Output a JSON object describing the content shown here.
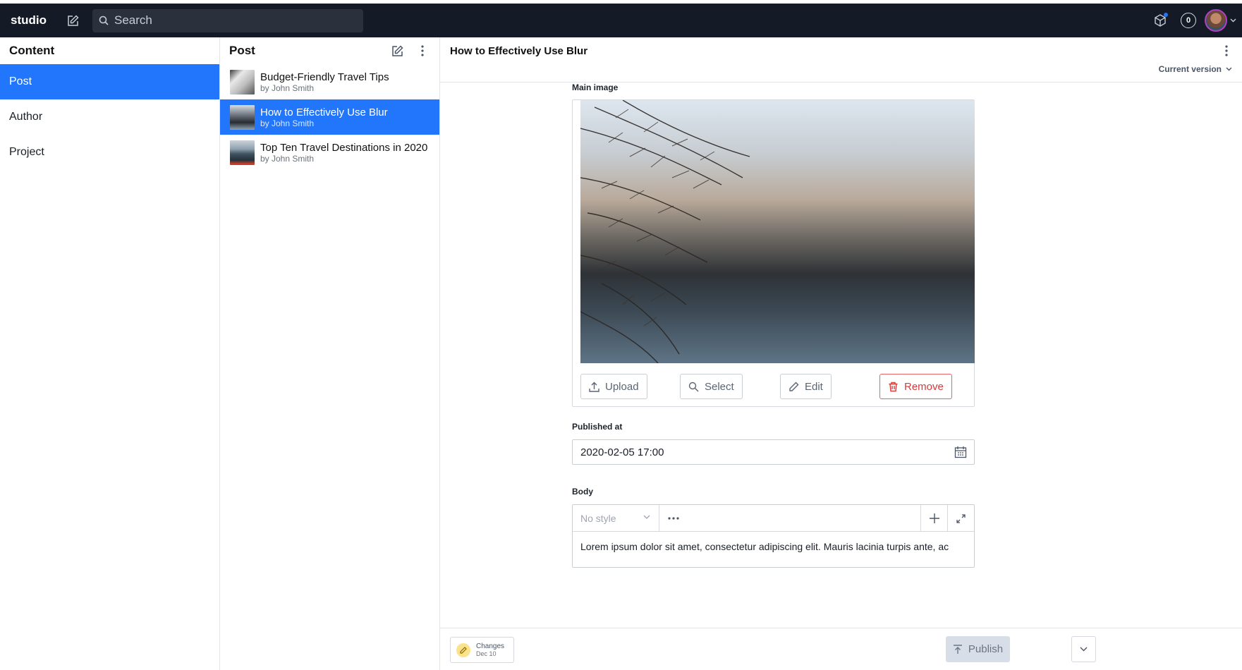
{
  "app": {
    "brand": "studio",
    "search_placeholder": "Search",
    "notification_count": "0"
  },
  "content_pane": {
    "title": "Content",
    "items": [
      {
        "label": "Post",
        "active": true
      },
      {
        "label": "Author",
        "active": false
      },
      {
        "label": "Project",
        "active": false
      }
    ]
  },
  "post_pane": {
    "title": "Post",
    "documents": [
      {
        "title": "Budget-Friendly Travel Tips",
        "subtitle": "by John Smith",
        "active": false
      },
      {
        "title": "How to Effectively Use Blur",
        "subtitle": "by John Smith",
        "active": true
      },
      {
        "title": "Top Ten Travel Destinations in 2020",
        "subtitle": "by John Smith",
        "active": false
      }
    ]
  },
  "document": {
    "title": "How to Effectively Use Blur",
    "version_label": "Current version",
    "main_image_label": "Main image",
    "image_buttons": {
      "upload": "Upload",
      "select": "Select",
      "edit": "Edit",
      "remove": "Remove"
    },
    "published_label": "Published at",
    "published_value": "2020-02-05 17:00",
    "body_label": "Body",
    "style_placeholder": "No style",
    "body_text": "Lorem ipsum dolor sit amet, consectetur adipiscing elit. Mauris lacinia turpis ante, ac"
  },
  "footer": {
    "changes_label": "Changes",
    "changes_date": "Dec 10",
    "publish_label": "Publish"
  },
  "colors": {
    "topbar": "#141a26",
    "accent": "#2276fc",
    "danger": "#d23c3c"
  }
}
